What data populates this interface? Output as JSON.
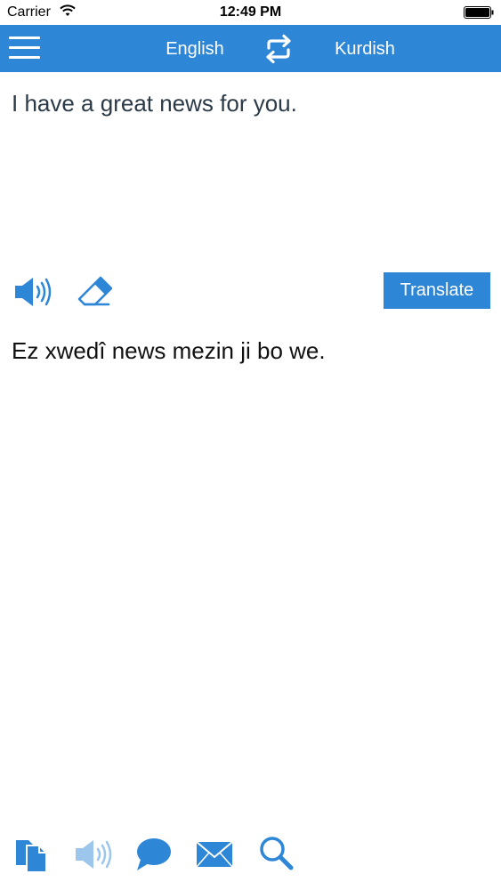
{
  "status_bar": {
    "carrier": "Carrier",
    "time": "12:49 PM"
  },
  "nav": {
    "source_language": "English",
    "target_language": "Kurdish",
    "accent_color": "#2e86d6"
  },
  "input": {
    "text": "I have a great news for you."
  },
  "actions": {
    "translate_label": "Translate"
  },
  "output": {
    "text": "Ez xwedî news mezin ji bo we."
  },
  "toolbar": {
    "icons": [
      "copy-icon",
      "speaker-icon",
      "chat-bubble-icon",
      "mail-icon",
      "search-icon"
    ]
  }
}
